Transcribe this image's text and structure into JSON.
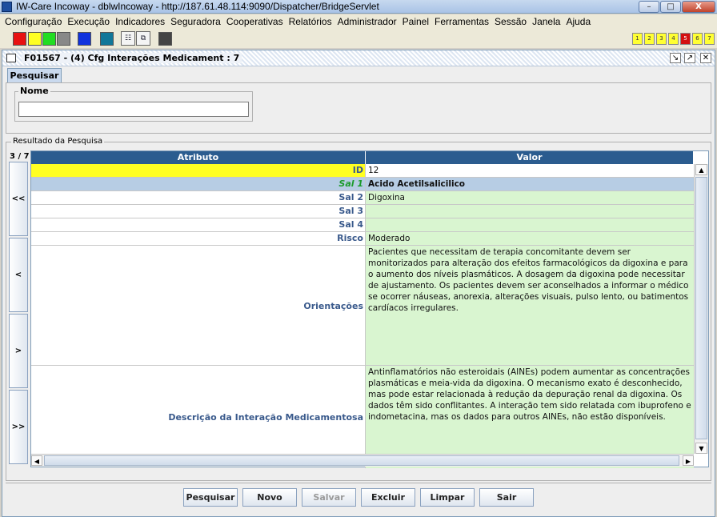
{
  "window": {
    "title": "IW-Care Incoway - dblwIncoway - http://187.61.48.114:9090/Dispatcher/BridgeServlet",
    "minimize": "–",
    "maximize": "□",
    "close": "X"
  },
  "menu": [
    "Configuração",
    "Execução",
    "Indicadores",
    "Seguradora",
    "Cooperativas",
    "Relatórios",
    "Administrador",
    "Painel",
    "Ferramentas",
    "Sessão",
    "Janela",
    "Ajuda"
  ],
  "toolbar": {
    "swatch_colors": [
      "#e81111",
      "#ffff22",
      "#22dd22",
      "#888888",
      "#1133dd",
      "#117799",
      "#444444"
    ],
    "numbers": [
      "1",
      "2",
      "3",
      "4",
      "5",
      "6",
      "7"
    ],
    "active_number": "5"
  },
  "frame": {
    "title": "F01567 - (4) Cfg Interações Medicament : 7"
  },
  "tab": {
    "label": "Pesquisar"
  },
  "search": {
    "label": "Nome",
    "value": ""
  },
  "results": {
    "legend": "Resultado da Pesquisa",
    "counter": "3 / 7",
    "columns": [
      "Atributo",
      "Valor"
    ],
    "nav": [
      "<<",
      "<",
      ">",
      ">>"
    ],
    "rows": [
      {
        "attr": "ID",
        "value": "12"
      },
      {
        "attr": "Sal 1",
        "value": "Acido Acetilsalicilico"
      },
      {
        "attr": "Sal 2",
        "value": "Digoxina"
      },
      {
        "attr": "Sal 3",
        "value": ""
      },
      {
        "attr": "Sal 4",
        "value": ""
      },
      {
        "attr": "Risco",
        "value": "Moderado"
      },
      {
        "attr": "Orientações",
        "value": "Pacientes que necessitam de terapia concomitante devem ser monitorizados para alteração dos efeitos farmacológicos da digoxina e para o aumento dos níveis plasmáticos. A dosagem da digoxina pode necessitar de ajustamento. Os pacientes devem ser aconselhados a informar o médico se ocorrer náuseas, anorexia, alterações visuais, pulso lento, ou batimentos cardíacos irregulares."
      },
      {
        "attr": "Descrição da Interação Medicamentosa",
        "value": "Antinflamatórios não esteroidais (AINEs) podem aumentar as concentrações plasmáticas e meia-vida da digoxina. O mecanismo exato é desconhecido, mas pode estar relacionada à redução da depuração renal da digoxina. Os dados têm sido conflitantes. A interação tem sido relatada com ibuprofeno e indometacina, mas os dados para outros AINEs, não estão disponíveis."
      }
    ]
  },
  "buttons": {
    "pesquisar": "Pesquisar",
    "novo": "Novo",
    "salvar": "Salvar",
    "excluir": "Excluir",
    "limpar": "Limpar",
    "sair": "Sair"
  }
}
